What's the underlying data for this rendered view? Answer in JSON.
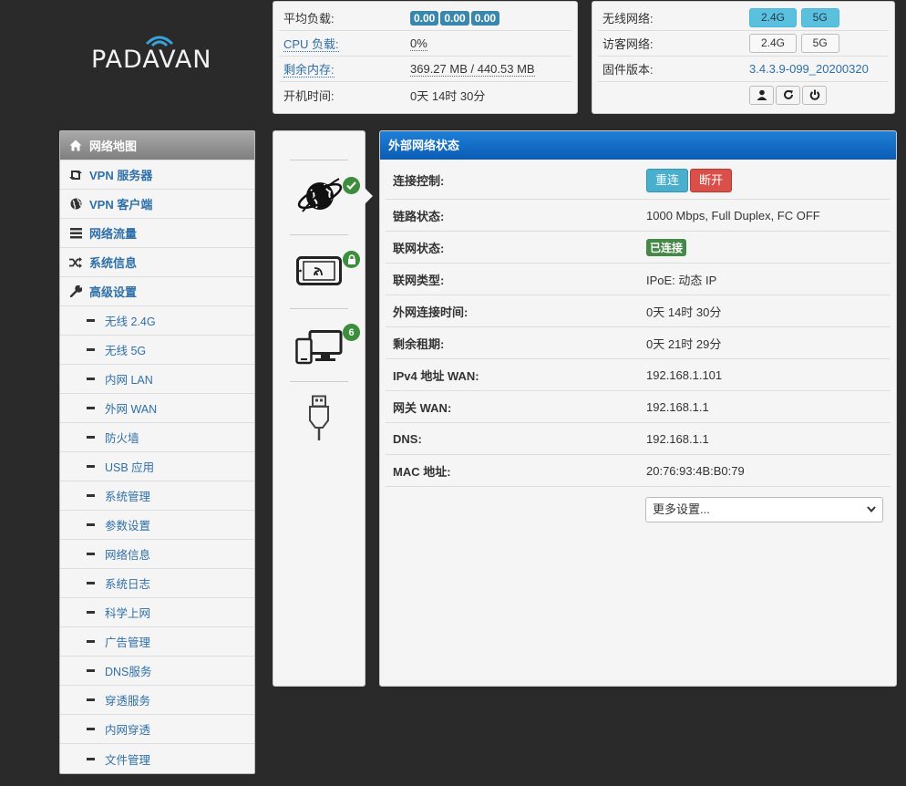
{
  "logo": {
    "text": "PADAVAN"
  },
  "stats": {
    "rows": [
      {
        "label": "平均负载:",
        "loads": [
          "0.00",
          "0.00",
          "0.00"
        ]
      },
      {
        "label": "CPU 负载:",
        "value": "0%"
      },
      {
        "label": "剩余内存:",
        "value": "369.27 MB / 440.53 MB"
      },
      {
        "label": "开机时间:",
        "value": "0天 14时 30分"
      }
    ]
  },
  "firmware": {
    "wireless_label": "无线网络:",
    "guest_label": "访客网络:",
    "version_label": "固件版本:",
    "band_24": "2.4G",
    "band_5": "5G",
    "version": "3.4.3.9-099_20200320",
    "icons": [
      "user-icon",
      "refresh-icon",
      "power-icon"
    ]
  },
  "sidebar": {
    "items": [
      {
        "label": "网络地图",
        "icon": "home-icon",
        "active": true
      },
      {
        "label": "VPN 服务器",
        "icon": "retweet-icon"
      },
      {
        "label": "VPN 客户端",
        "icon": "globe-icon"
      },
      {
        "label": "网络流量",
        "icon": "list-icon"
      },
      {
        "label": "系统信息",
        "icon": "random-icon"
      },
      {
        "label": "高级设置",
        "icon": "wrench-icon"
      }
    ],
    "subitems": [
      "无线 2.4G",
      "无线 5G",
      "内网 LAN",
      "外网 WAN",
      "防火墙",
      "USB 应用",
      "系统管理",
      "参数设置",
      "网络信息",
      "系统日志",
      "科学上网",
      "广告管理",
      "DNS服务",
      "穿透服务",
      "内网穿透",
      "文件管理"
    ]
  },
  "devices": {
    "clients_count": "6",
    "icons": [
      "internet-globe-icon",
      "wireless-tablet-icon",
      "clients-devices-icon",
      "usb-icon"
    ]
  },
  "main": {
    "title": "外部网络状态",
    "rows": [
      {
        "key": "连接控制:",
        "reconnect": "重连",
        "disconnect": "断开"
      },
      {
        "key": "链路状态:",
        "value": "1000 Mbps, Full Duplex, FC OFF"
      },
      {
        "key": "联网状态:",
        "status": "已连接"
      },
      {
        "key": "联网类型:",
        "value": "IPoE: 动态 IP"
      },
      {
        "key": "外网连接时间:",
        "value": "0天 14时 30分"
      },
      {
        "key": "剩余租期:",
        "value": "0天 21时 29分"
      },
      {
        "key": "IPv4 地址 WAN:",
        "value": "192.168.1.101"
      },
      {
        "key": "网关 WAN:",
        "value": "192.168.1.1"
      },
      {
        "key": "DNS:",
        "value": "192.168.1.1"
      },
      {
        "key": "MAC 地址:",
        "value": "20:76:93:4B:B0:79"
      }
    ],
    "more_select": "更多设置..."
  },
  "colors": {
    "accent": "#0a5cb5",
    "link": "#2f6fa8",
    "success": "#468847",
    "danger": "#da4f49",
    "info": "#49afcd"
  }
}
